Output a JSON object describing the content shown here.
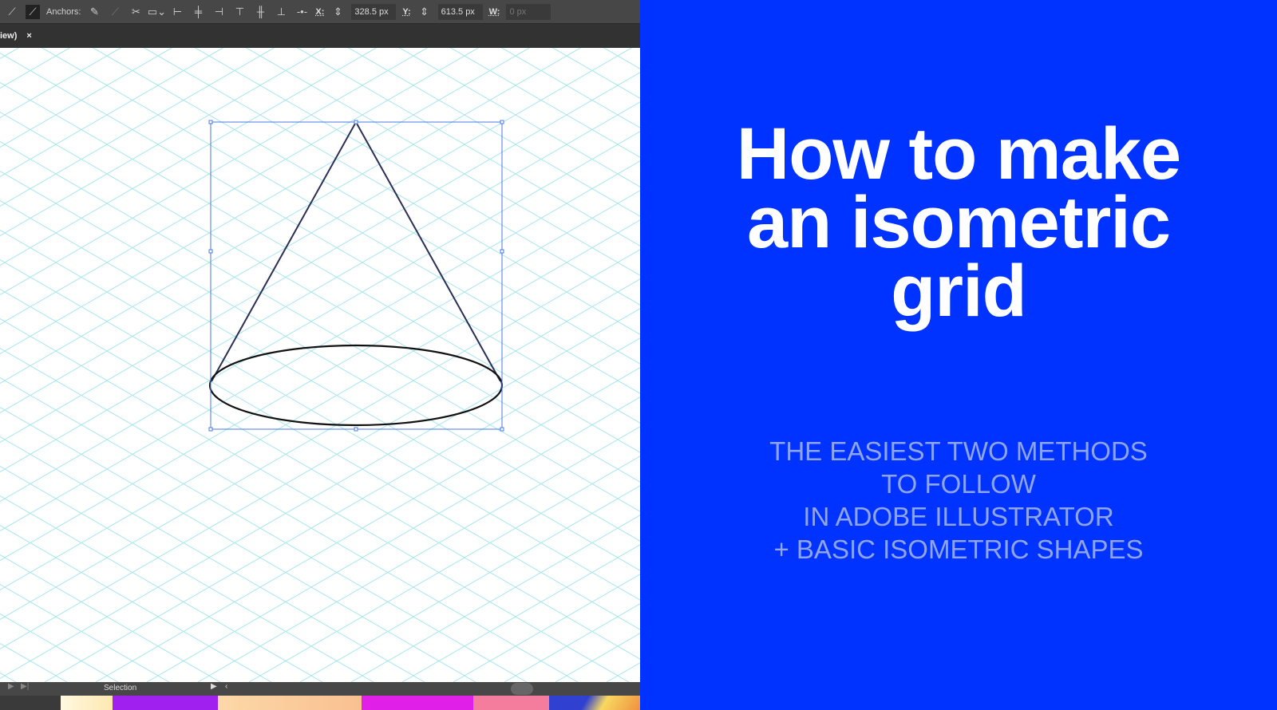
{
  "toolbar": {
    "anchors_label": "Anchors:",
    "x_label": "X:",
    "x_value": "328.5 px",
    "y_label": "Y:",
    "y_value": "613.5 px",
    "w_label": "W:",
    "w_value": "0 px"
  },
  "tab": {
    "label": "iew)",
    "close": "×"
  },
  "status": {
    "mode": "Selection"
  },
  "slide": {
    "title_lines": [
      "How to make",
      "an isometric",
      "grid"
    ],
    "subtitle_lines": [
      "THE EASIEST TWO METHODS",
      "TO FOLLOW",
      "IN ADOBE ILLUSTRATOR",
      "+ BASIC ISOMETRIC SHAPES"
    ]
  },
  "colors": {
    "brand_blue": "#0033ff",
    "grid": "#a9e6ef",
    "selection": "#4a78e0"
  }
}
